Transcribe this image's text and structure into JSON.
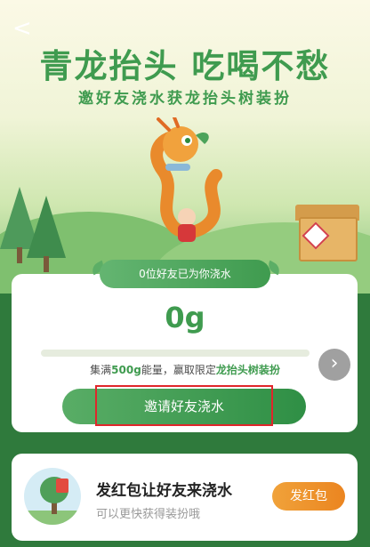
{
  "nav": {
    "back_icon": "chevron-left-icon",
    "back_glyph": "<"
  },
  "hero": {
    "title": "青龙抬头 吃喝不愁",
    "subtitle": "邀好友浇水获龙抬头树装扮"
  },
  "progress_card": {
    "friends_watered": "0位好友已为你浇水",
    "amount": "0g",
    "progress": 0,
    "goal_prefix": "集满",
    "goal_amount": "500g",
    "goal_middle": "能量，赢取限定",
    "goal_reward": "龙抬头树装扮",
    "next_glyph": "›",
    "invite_label": "邀请好友浇水"
  },
  "bottom_card": {
    "title": "发红包让好友来浇水",
    "subtitle": "可以更快获得装扮哦",
    "button_label": "发红包"
  },
  "colors": {
    "accent": "#3f9b4f",
    "orange": "#eb8520",
    "highlight_border": "#e0262b"
  }
}
